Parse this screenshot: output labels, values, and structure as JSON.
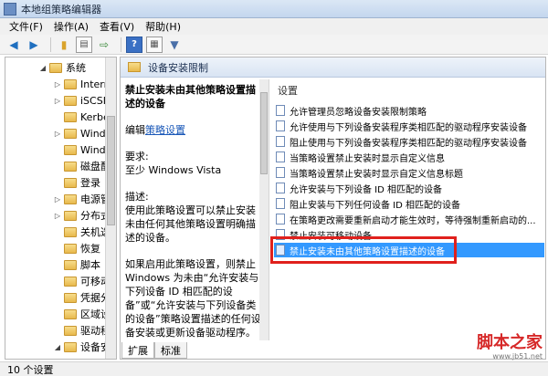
{
  "window": {
    "title": "本地组策略编辑器"
  },
  "menu": [
    "文件(F)",
    "操作(A)",
    "查看(V)",
    "帮助(H)"
  ],
  "toolbar": {
    "icons": [
      "back-icon",
      "forward-icon",
      "folder-up-icon",
      "show-hide-tree-icon",
      "export-icon",
      "help-icon",
      "view-icon",
      "filter-icon"
    ]
  },
  "tree": {
    "items": [
      {
        "label": "系统",
        "expanded": "◢"
      },
      {
        "label": "Intern",
        "expanded": "▷"
      },
      {
        "label": "iSCSI",
        "expanded": "▷"
      },
      {
        "label": "Kerbe",
        "expanded": ""
      },
      {
        "label": "Windo",
        "expanded": "▷"
      },
      {
        "label": "Windo",
        "expanded": ""
      },
      {
        "label": "磁盘配",
        "expanded": ""
      },
      {
        "label": "登录",
        "expanded": ""
      },
      {
        "label": "电源管",
        "expanded": "▷"
      },
      {
        "label": "分布式",
        "expanded": "▷"
      },
      {
        "label": "关机选",
        "expanded": ""
      },
      {
        "label": "恢复",
        "expanded": ""
      },
      {
        "label": "脚本",
        "expanded": ""
      },
      {
        "label": "可移动",
        "expanded": ""
      },
      {
        "label": "凭据分",
        "expanded": ""
      },
      {
        "label": "区域设",
        "expanded": ""
      },
      {
        "label": "驱动程",
        "expanded": ""
      },
      {
        "label": "设备安",
        "expanded": "◢"
      },
      {
        "label": "设",
        "expanded": ""
      }
    ]
  },
  "right": {
    "header": "设备安装限制",
    "description": {
      "title": "禁止安装未由其他策略设置描述的设备",
      "edit_prefix": "编辑",
      "edit_link": "策略设置",
      "req_label": "要求:",
      "req_value": "至少 Windows Vista",
      "desc_label": "描述:",
      "desc_text": "使用此策略设置可以禁止安装未由任何其他策略设置明确描述的设备。",
      "more_text": "如果启用此策略设置，则禁止 Windows 为未由“允许安装与下列设备 ID 相匹配的设备”或“允许安装与下列设备类的设备”策略设置描述的任何设备安装或更新设备驱动程序。"
    },
    "list": {
      "column_header": "设置",
      "items": [
        "允许管理员忽略设备安装限制策略",
        "允许使用与下列设备安装程序类相匹配的驱动程序安装设备",
        "阻止使用与下列设备安装程序类相匹配的驱动程序安装设备",
        "当策略设置禁止安装时显示自定义信息",
        "当策略设置禁止安装时显示自定义信息标题",
        "允许安装与下列设备 ID 相匹配的设备",
        "阻止安装与下列任何设备 ID 相匹配的设备",
        "在策略更改需要重新启动才能生效时，等待强制重新启动的...",
        "禁止安装可移动设备",
        "禁止安装未由其他策略设置描述的设备"
      ],
      "selected_index": 9
    },
    "tabs": [
      "扩展",
      "标准"
    ]
  },
  "status": {
    "text": "10 个设置"
  },
  "watermark": {
    "line1": "脚本之家",
    "line2": "www.jb51.net"
  }
}
